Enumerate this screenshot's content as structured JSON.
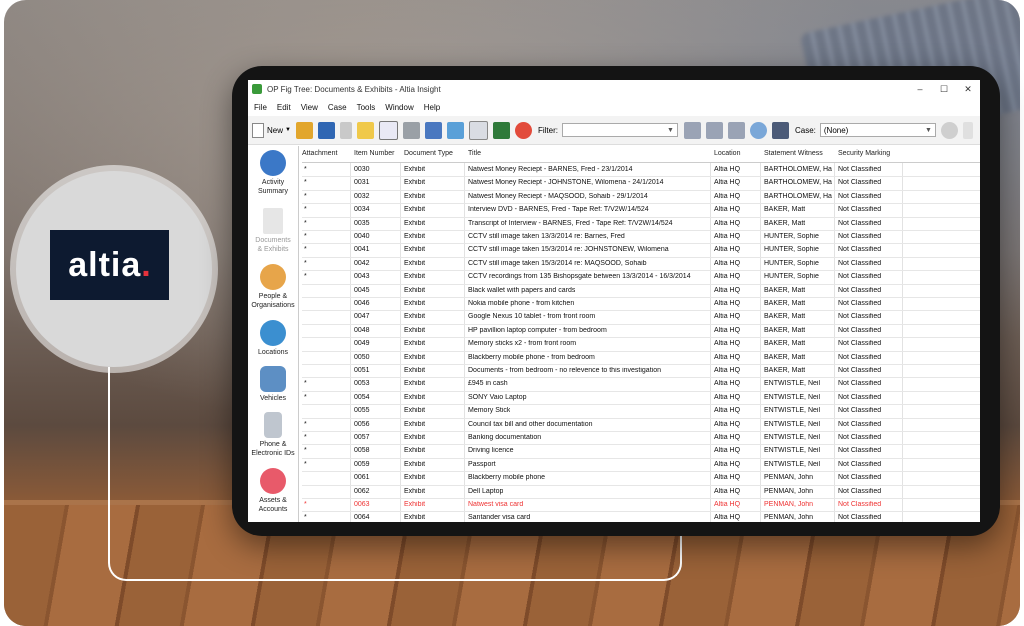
{
  "brand": {
    "logo_text": "altia",
    "logo_dot": ".",
    "accent": "#e5323c",
    "navy": "#0d1a30"
  },
  "window": {
    "title": "OP Fig Tree: Documents & Exhibits - Altia Insight",
    "controls": [
      "–",
      "☐",
      "✕"
    ]
  },
  "menu": [
    "File",
    "Edit",
    "View",
    "Case",
    "Tools",
    "Window",
    "Help"
  ],
  "toolbar": {
    "new_label": "New",
    "filter_label": "Filter:",
    "filter_value": "",
    "case_label": "Case:",
    "case_value": "(None)"
  },
  "sidebar": [
    {
      "label1": "Activity",
      "label2": "Summary",
      "icon": "activity-gauge-icon"
    },
    {
      "label1": "Documents",
      "label2": "& Exhibits",
      "icon": "documents-icon"
    },
    {
      "label1": "People &",
      "label2": "Organisations",
      "icon": "people-icon"
    },
    {
      "label1": "Locations",
      "label2": "",
      "icon": "globe-icon"
    },
    {
      "label1": "Vehicles",
      "label2": "",
      "icon": "vehicle-icon"
    },
    {
      "label1": "Phone &",
      "label2": "Electronic IDs",
      "icon": "phone-icon"
    },
    {
      "label1": "Assets &",
      "label2": "Accounts",
      "icon": "piggy-bank-icon"
    }
  ],
  "table": {
    "columns": [
      "Attachment",
      "Item Number",
      "Document Type",
      "Title",
      "Location",
      "Statement Witness",
      "Security Marking"
    ],
    "rows": [
      [
        "*",
        "0030",
        "Exhibit",
        "Natwest Money Reciept - BARNES, Fred - 23/1/2014",
        "Altia HQ",
        "BARTHOLOMEW, Ha...",
        "Not Classified"
      ],
      [
        "*",
        "0031",
        "Exhibit",
        "Natwest Money Reciept - JOHNSTONE, Wilomena - 24/1/2014",
        "Altia HQ",
        "BARTHOLOMEW, Ha...",
        "Not Classified"
      ],
      [
        "*",
        "0032",
        "Exhibit",
        "Natwest Money Reciept - MAQSOOD, Sohaib - 29/1/2014",
        "Altia HQ",
        "BARTHOLOMEW, Ha...",
        "Not Classified"
      ],
      [
        "*",
        "0034",
        "Exhibit",
        "Interview DVD - BARNES, Fred - Tape Ref: T/V2W/14/524",
        "Altia HQ",
        "BAKER, Matt",
        "Not Classified"
      ],
      [
        "*",
        "0035",
        "Exhibit",
        "Transcript of Interview - BARNES, Fred - Tape Ref: T/V2W/14/524",
        "Altia HQ",
        "BAKER, Matt",
        "Not Classified"
      ],
      [
        "*",
        "0040",
        "Exhibit",
        "CCTV still image taken 13/3/2014 re: Barnes, Fred",
        "Altia HQ",
        "HUNTER, Sophie",
        "Not Classified"
      ],
      [
        "*",
        "0041",
        "Exhibit",
        "CCTV still image taken 15/3/2014 re: JOHNSTONEW, Wilomena",
        "Altia HQ",
        "HUNTER, Sophie",
        "Not Classified"
      ],
      [
        "*",
        "0042",
        "Exhibit",
        "CCTV still image taken 15/3/2014 re: MAQSOOD, Sohaib",
        "Altia HQ",
        "HUNTER, Sophie",
        "Not Classified"
      ],
      [
        "*",
        "0043",
        "Exhibit",
        "CCTV recordings from 135 Bishopsgate between 13/3/2014 - 16/3/2014",
        "Altia HQ",
        "HUNTER, Sophie",
        "Not Classified"
      ],
      [
        "",
        "0045",
        "Exhibit",
        "Black wallet with papers and cards",
        "Altia HQ",
        "BAKER, Matt",
        "Not Classified"
      ],
      [
        "",
        "0046",
        "Exhibit",
        "Nokia mobile phone - from kitchen",
        "Altia HQ",
        "BAKER, Matt",
        "Not Classified"
      ],
      [
        "",
        "0047",
        "Exhibit",
        "Google Nexus 10 tablet - from front room",
        "Altia HQ",
        "BAKER, Matt",
        "Not Classified"
      ],
      [
        "",
        "0048",
        "Exhibit",
        "HP pavillion laptop computer - from bedroom",
        "Altia HQ",
        "BAKER, Matt",
        "Not Classified"
      ],
      [
        "",
        "0049",
        "Exhibit",
        "Memory sticks x2 - from front room",
        "Altia HQ",
        "BAKER, Matt",
        "Not Classified"
      ],
      [
        "",
        "0050",
        "Exhibit",
        "Blackberry mobile phone - from bedroom",
        "Altia HQ",
        "BAKER, Matt",
        "Not Classified"
      ],
      [
        "",
        "0051",
        "Exhibit",
        "Documents - from bedroom - no relevence to this investigation",
        "Altia HQ",
        "BAKER, Matt",
        "Not Classified"
      ],
      [
        "*",
        "0053",
        "Exhibit",
        "£945 in cash",
        "Altia HQ",
        "ENTWISTLE, Neil",
        "Not Classified"
      ],
      [
        "*",
        "0054",
        "Exhibit",
        "SONY Vaio Laptop",
        "Altia HQ",
        "ENTWISTLE, Neil",
        "Not Classified"
      ],
      [
        "",
        "0055",
        "Exhibit",
        "Memory Stick",
        "Altia HQ",
        "ENTWISTLE, Neil",
        "Not Classified"
      ],
      [
        "*",
        "0056",
        "Exhibit",
        "Council tax bill and other documentation",
        "Altia HQ",
        "ENTWISTLE, Neil",
        "Not Classified"
      ],
      [
        "*",
        "0057",
        "Exhibit",
        "Banking documentation",
        "Altia HQ",
        "ENTWISTLE, Neil",
        "Not Classified"
      ],
      [
        "*",
        "0058",
        "Exhibit",
        "Driving licence",
        "Altia HQ",
        "ENTWISTLE, Neil",
        "Not Classified"
      ],
      [
        "*",
        "0059",
        "Exhibit",
        "Passport",
        "Altia HQ",
        "ENTWISTLE, Neil",
        "Not Classified"
      ],
      [
        "",
        "0061",
        "Exhibit",
        "Blackberry mobile phone",
        "Altia HQ",
        "PENMAN, John",
        "Not Classified"
      ],
      [
        "",
        "0062",
        "Exhibit",
        "Dell Laptop",
        "Altia HQ",
        "PENMAN, John",
        "Not Classified"
      ],
      [
        "*",
        "0063",
        "Exhibit",
        "Natwest visa card",
        "Altia HQ",
        "PENMAN, John",
        "Not Classified"
      ],
      [
        "*",
        "0064",
        "Exhibit",
        "Santander visa card",
        "Altia HQ",
        "PENMAN, John",
        "Not Classified"
      ]
    ],
    "highlight_row_color": "#e33333"
  }
}
